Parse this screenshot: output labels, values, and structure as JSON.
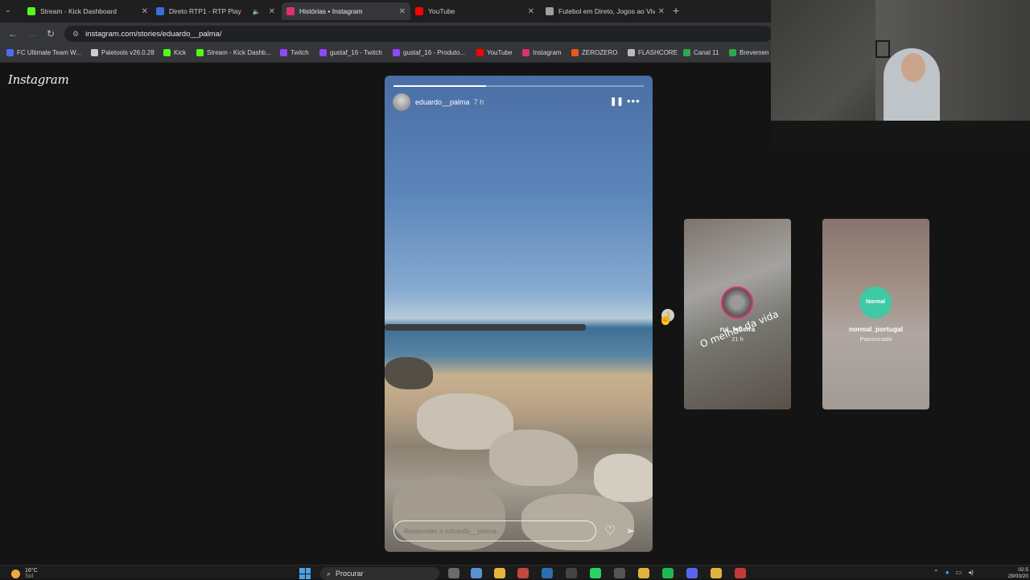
{
  "browser": {
    "tabs": [
      {
        "title": "Stream - Kick Dashboard",
        "favicon_color": "#53fc18",
        "active": false
      },
      {
        "title": "Direto RTP1 - RTP Play",
        "favicon_color": "#3b6fd8",
        "active": false,
        "audio": true
      },
      {
        "title": "Histórias • Instagram",
        "favicon_color": "#e1306c",
        "active": true
      },
      {
        "title": "YouTube",
        "favicon_color": "#ff0000",
        "active": false
      },
      {
        "title": "Futebol em Direto, Jogos ao Vivo",
        "favicon_color": "#9aa0a6",
        "active": false
      }
    ],
    "url": "instagram.com/stories/eduardo__palma/",
    "bookmarks": [
      {
        "label": "FC Ultimate Team W...",
        "color": "#4a6cf7"
      },
      {
        "label": "Paletools v26.0.28",
        "color": "#cccccc"
      },
      {
        "label": "Kick",
        "color": "#53fc18"
      },
      {
        "label": "Stream - Kick Dashb...",
        "color": "#53fc18"
      },
      {
        "label": "Twitch",
        "color": "#9146ff"
      },
      {
        "label": "gustaf_16 - Twitch",
        "color": "#9146ff"
      },
      {
        "label": "gustaf_16 - Produto...",
        "color": "#9146ff"
      },
      {
        "label": "YouTube",
        "color": "#ff0000"
      },
      {
        "label": "Instagram",
        "color": "#e1306c"
      },
      {
        "label": "ZEROZERO",
        "color": "#e85a1b"
      },
      {
        "label": "FLASHCORE",
        "color": "#bbbbbb"
      },
      {
        "label": "Canal 11",
        "color": "#2fa84f"
      },
      {
        "label": "Brevemen",
        "color": "#2fa84f"
      }
    ]
  },
  "instagram": {
    "logo": "Instagram",
    "story": {
      "username": "eduardo__palma",
      "time": "7 h",
      "progress": 0.37,
      "reply_placeholder": "Responder a eduardo__palma..."
    },
    "previews": [
      {
        "username": "rui_feiteira",
        "sub": "21 h",
        "caption": "O melhor da vida"
      },
      {
        "username": "normal_portugal",
        "sub": "Patrocinado",
        "avatar_text": "Normal"
      }
    ]
  },
  "taskbar": {
    "weather_temp": "16°C",
    "weather_desc": "Sol",
    "search_label": "Procurar",
    "time": "02:5",
    "date": "29/03/20"
  }
}
